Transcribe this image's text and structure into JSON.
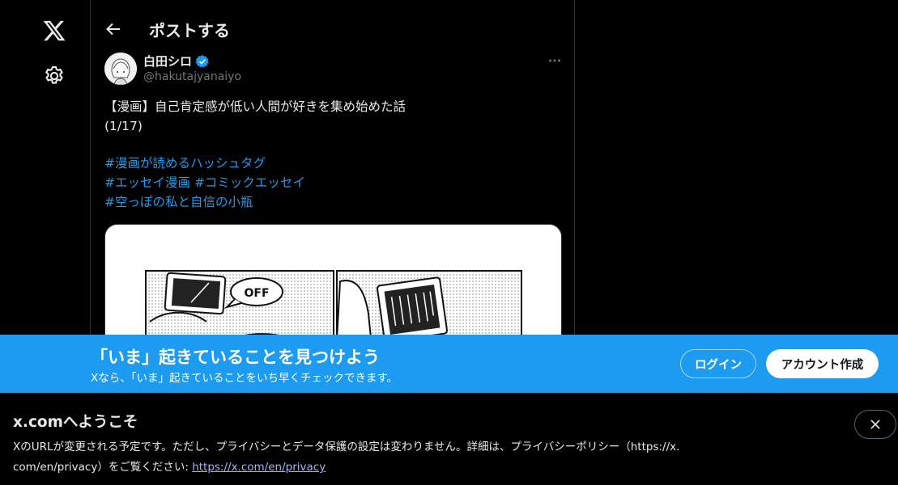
{
  "nav": {
    "logo_icon": "x-logo-icon",
    "settings_icon": "gear-icon"
  },
  "header": {
    "title": "ポストする",
    "back_icon": "back-arrow-icon"
  },
  "post": {
    "author_name": "白田シロ",
    "handle": "@hakutajyanaiyo",
    "verified": true,
    "verified_color": "#1d9bf0",
    "text_line1": "【漫画】自己肯定感が低い人間が好きを集め始めた話",
    "text_line2": "(1/17)",
    "hashtags": [
      "#漫画が読めるハッシュタグ",
      "#エッセイ漫画",
      "#コミックエッセイ",
      "#空っぽの私と自信の小瓶"
    ],
    "media_text": "OFF"
  },
  "banner": {
    "title": "「いま」起きていることを見つけよう",
    "subtitle": "Xなら、「いま」起きていることをいち早くチェックできます。",
    "login_label": "ログイン",
    "signup_label": "アカウント作成",
    "color": "#1d9bf0"
  },
  "notice": {
    "title": "x.comへようこそ",
    "body_line1": "XのURLが変更される予定です。ただし、プライバシーとデータ保護の設定は変わりません。詳細は、プライバシーポリシー（https://x.",
    "body_line2": "com/en/privacy）をご覧ください: ",
    "link_text": "https://x.com/en/privacy"
  }
}
